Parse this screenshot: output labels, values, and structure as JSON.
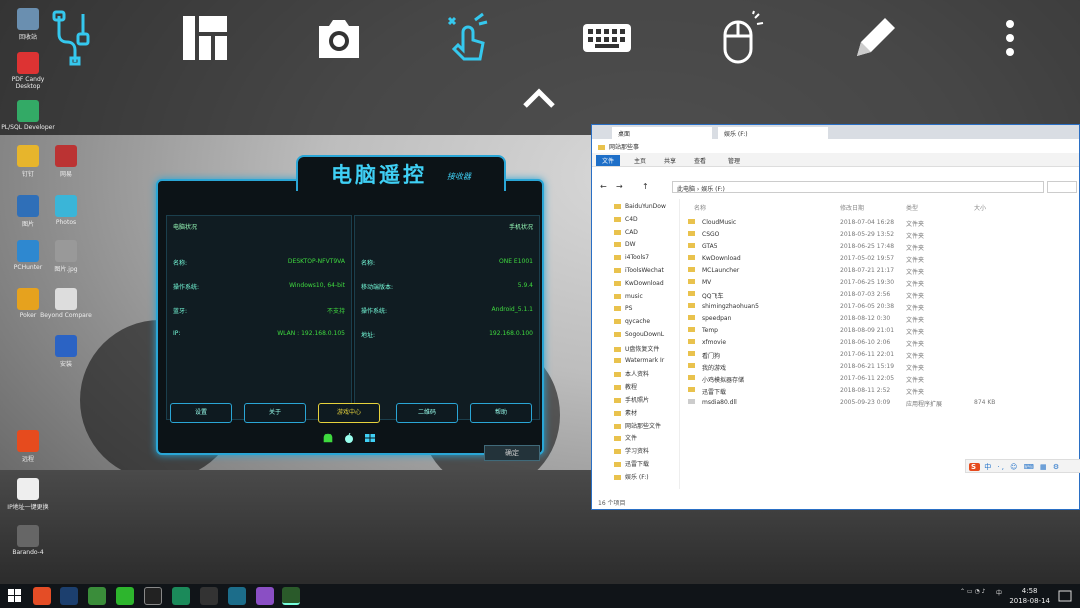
{
  "remote_app": {
    "title": "电脑遥控",
    "subtitle": "接收器",
    "pc_panel": {
      "header": "电脑状况",
      "rows": [
        {
          "label": "名称:",
          "value": "DESKTOP-NFVT9VA"
        },
        {
          "label": "操作系统:",
          "value": "Windows10, 64-bit"
        },
        {
          "label": "蓝牙:",
          "value": "不支持"
        },
        {
          "label": "IP:",
          "value": "WLAN : 192.168.0.105"
        }
      ]
    },
    "phone_panel": {
      "header": "手机状况",
      "rows": [
        {
          "label": "名称:",
          "value": "ONE E1001"
        },
        {
          "label": "移动端版本:",
          "value": "5.9.4"
        },
        {
          "label": "操作系统:",
          "value": "Android_5.1.1"
        },
        {
          "label": "地址:",
          "value": "192.168.0.100"
        }
      ]
    },
    "buttons": [
      "设置",
      "关于",
      "游戏中心",
      "二维码",
      "帮助"
    ],
    "ok_label": "确定"
  },
  "explorer": {
    "tabs": [
      "桌面",
      "娱乐 (F:)"
    ],
    "title": "网站那些事",
    "ribbon_tabs": [
      "文件",
      "主页",
      "共享",
      "查看",
      "管理"
    ],
    "path": "此电脑 › 娱乐 (F:)",
    "columns": [
      "名称",
      "修改日期",
      "类型",
      "大小"
    ],
    "nav_items": [
      "BaiduYunDow",
      "C4D",
      "CAD",
      "DW",
      "i4Tools7",
      "iToolsWechat",
      "KwDownload",
      "music",
      "PS",
      "qycache",
      "SogouDownL",
      "U盘恢复文件",
      "Watermark Ir",
      "本人资料",
      "教程",
      "手机照片",
      "素材",
      "网站那些文件",
      "文件",
      "学习资料",
      "迅雷下载",
      "娱乐 (F:)"
    ],
    "files": [
      {
        "name": "CloudMusic",
        "date": "2018-07-04 16:28",
        "type": "文件夹",
        "size": ""
      },
      {
        "name": "CSGO",
        "date": "2018-05-29 13:52",
        "type": "文件夹",
        "size": ""
      },
      {
        "name": "GTA5",
        "date": "2018-06-25 17:48",
        "type": "文件夹",
        "size": ""
      },
      {
        "name": "KwDownload",
        "date": "2017-05-02 19:57",
        "type": "文件夹",
        "size": ""
      },
      {
        "name": "MCLauncher",
        "date": "2018-07-21 21:17",
        "type": "文件夹",
        "size": ""
      },
      {
        "name": "MV",
        "date": "2017-06-25 19:30",
        "type": "文件夹",
        "size": ""
      },
      {
        "name": "QQ飞车",
        "date": "2018-07-03 2:56",
        "type": "文件夹",
        "size": ""
      },
      {
        "name": "shimingzhaohuan5",
        "date": "2017-06-05 20:38",
        "type": "文件夹",
        "size": ""
      },
      {
        "name": "speedpan",
        "date": "2018-08-12 0:30",
        "type": "文件夹",
        "size": ""
      },
      {
        "name": "Temp",
        "date": "2018-08-09 21:01",
        "type": "文件夹",
        "size": ""
      },
      {
        "name": "xfmovie",
        "date": "2018-06-10 2:06",
        "type": "文件夹",
        "size": ""
      },
      {
        "name": "看门狗",
        "date": "2017-06-11 22:01",
        "type": "文件夹",
        "size": ""
      },
      {
        "name": "我的游戏",
        "date": "2018-06-21 15:19",
        "type": "文件夹",
        "size": ""
      },
      {
        "name": "小鸡模拟器存储",
        "date": "2017-06-11 22:05",
        "type": "文件夹",
        "size": ""
      },
      {
        "name": "迅雷下载",
        "date": "2018-08-11 2:52",
        "type": "文件夹",
        "size": ""
      },
      {
        "name": "msdia80.dll",
        "date": "2005-09-23 0:09",
        "type": "应用程序扩展",
        "size": "874 KB"
      }
    ],
    "status": "16 个项目",
    "ime_text": "中 ·, ☺ ⌨ ▦ ⚙"
  },
  "desktop_icons": [
    "回收站",
    "PDF Candy Desktop",
    "PL/SQL Developer",
    "钉钉",
    "网易",
    "Photos",
    "图片",
    "Poker",
    "图片.jpg",
    "Beyond Compare",
    "PCHunter",
    "安装",
    "远程",
    "IP地址一键更换",
    "Barando-4"
  ],
  "taskbar": {
    "time": "4:58",
    "date": "2018-08-14",
    "ime": "中"
  }
}
